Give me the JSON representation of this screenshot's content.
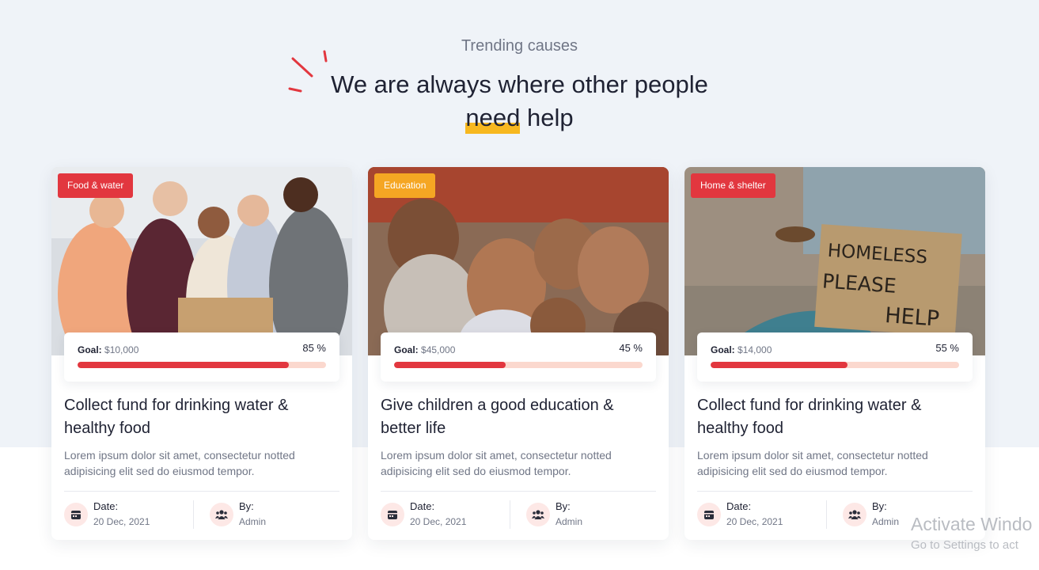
{
  "section": {
    "subtitle": "Trending causes",
    "title_line1": "We are always where other people",
    "title_highlight": "need",
    "title_rest": "help"
  },
  "cards": [
    {
      "badge": "Food & water",
      "badge_color": "#e2373f",
      "image_desc": "volunteers holding box",
      "goal_label": "Goal:",
      "goal_amount": "$10,000",
      "percent_text": "85 %",
      "progress": 0.85,
      "title": "Collect fund for drinking water & healthy food",
      "description": "Lorem ipsum dolor sit amet, consectetur notted adipisicing elit sed do eiusmod tempor.",
      "date_label": "Date:",
      "date_value": "20 Dec, 2021",
      "by_label": "By:",
      "by_value": "Admin"
    },
    {
      "badge": "Education",
      "badge_color": "#f5a623",
      "image_desc": "smiling children",
      "goal_label": "Goal:",
      "goal_amount": "$45,000",
      "percent_text": "45 %",
      "progress": 0.45,
      "title": "Give children a good education & better life",
      "description": "Lorem ipsum dolor sit amet, consectetur notted adipisicing elit sed do eiusmod tempor.",
      "date_label": "Date:",
      "date_value": "20 Dec, 2021",
      "by_label": "By:",
      "by_value": "Admin"
    },
    {
      "badge": "Home & shelter",
      "badge_color": "#e2373f",
      "image_sign": [
        "HOMELESS",
        "PLEASE",
        "HELP"
      ],
      "goal_label": "Goal:",
      "goal_amount": "$14,000",
      "percent_text": "55 %",
      "progress": 0.55,
      "title": "Collect fund for drinking water & healthy food",
      "description": "Lorem ipsum dolor sit amet, consectetur notted adipisicing elit sed do eiusmod tempor.",
      "date_label": "Date:",
      "date_value": "20 Dec, 2021",
      "by_label": "By:",
      "by_value": "Admin"
    }
  ],
  "watermark": {
    "line1": "Activate Windo",
    "line2": "Go to Settings to act"
  },
  "icons": {
    "date": "calendar-icon",
    "by": "users-icon"
  },
  "colors": {
    "accent": "#e2373f",
    "highlight": "#f7b81f",
    "progress_track": "#fbd8ce"
  }
}
